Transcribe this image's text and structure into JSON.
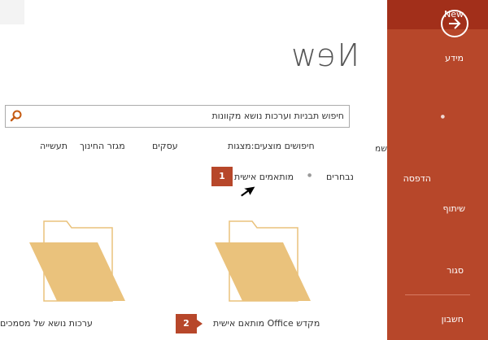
{
  "sidebar": {
    "back_icon": "arrow-right-circle-icon",
    "items": [
      {
        "label": "מידע"
      },
      {
        "label": "New"
      },
      {
        "label": "הדפסה"
      },
      {
        "label": "שיתוף"
      },
      {
        "label": "סגור"
      },
      {
        "label": "חשבון"
      }
    ],
    "partial_label": "שמ"
  },
  "main": {
    "title": "New",
    "search": {
      "value": "חיפוש תבניות וערכות נושא מקוונות",
      "icon": "search-icon"
    },
    "suggested": {
      "label": "חיפושים מוצעים:",
      "categories": [
        "מצגות",
        "עסקים",
        "מגזר החינוך",
        "תעשייה"
      ]
    },
    "tabs": {
      "featured": "נבחרים",
      "personal": "מותאמים אישית"
    },
    "callouts": [
      "1",
      "2"
    ],
    "tiles": [
      {
        "caption": "מקדש Office מותאם אישית",
        "icon": "folder-icon"
      },
      {
        "caption": "ערכות נושא של מסמכים",
        "icon": "folder-icon"
      }
    ]
  },
  "colors": {
    "accent": "#b7472a",
    "selected_nav": "#a22f1a",
    "folder": "#eac27c"
  }
}
